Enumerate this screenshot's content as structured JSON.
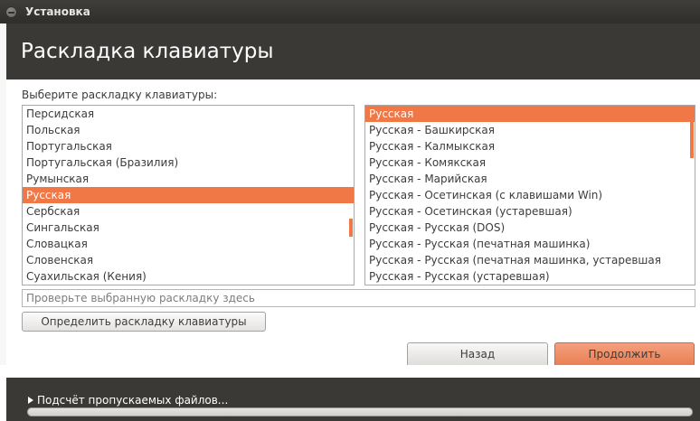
{
  "window": {
    "title": "Установка"
  },
  "header": {
    "title": "Раскладка клавиатуры"
  },
  "prompt": "Выберите раскладку клавиатуры:",
  "layout_list": {
    "items": [
      "Персидская",
      "Польская",
      "Португальская",
      "Португальская (Бразилия)",
      "Румынская",
      "Русская",
      "Сербская",
      "Сингальская",
      "Словацкая",
      "Словенская",
      "Суахильская (Кения)"
    ],
    "selected": "Русская"
  },
  "variant_list": {
    "items": [
      "Русская",
      "Русская - Башкирская",
      "Русская - Калмыкская",
      "Русская - Комякская",
      "Русская - Марийская",
      "Русская - Осетинская (с клавишами Win)",
      "Русская - Осетинская (устаревшая)",
      "Русская - Русская (DOS)",
      "Русская - Русская (печатная машинка)",
      "Русская - Русская (печатная машинка, устаревшая",
      "Русская - Русская (устаревшая)"
    ],
    "selected": "Русская"
  },
  "test_field": {
    "placeholder": "Проверьте выбранную раскладку здесь",
    "value": ""
  },
  "buttons": {
    "detect": "Определить раскладку клавиатуры",
    "back": "Назад",
    "continue": "Продолжить"
  },
  "progress": {
    "label": "Подсчёт пропускаемых файлов...",
    "fraction": 0
  },
  "colors": {
    "accent": "#f07746",
    "header_bg": "#3a3936",
    "titlebar_bg": "#3a3936"
  }
}
